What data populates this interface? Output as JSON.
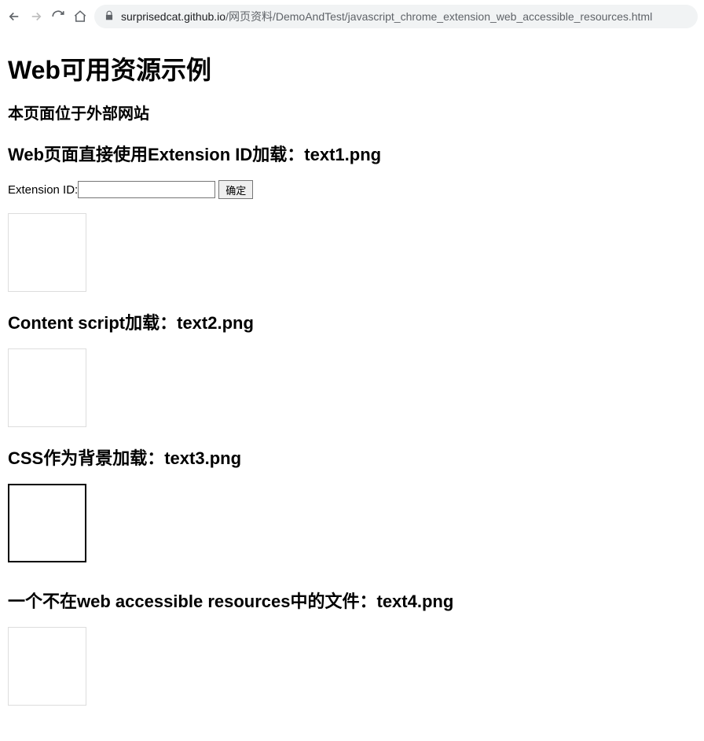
{
  "toolbar": {
    "url_host": "surprisedcat.github.io",
    "url_path": "/网页资料/DemoAndTest/javascript_chrome_extension_web_accessible_resources.html"
  },
  "page": {
    "h1": "Web可用资源示例",
    "h2": "本页面位于外部网站",
    "section1_title": "Web页面直接使用Extension ID加载：text1.png",
    "form": {
      "label": "Extension ID:",
      "value": "",
      "button": "确定"
    },
    "section2_title": "Content script加载：text2.png",
    "section3_title": "CSS作为背景加载：text3.png",
    "section4_title": "一个不在web accessible resources中的文件：text4.png"
  }
}
